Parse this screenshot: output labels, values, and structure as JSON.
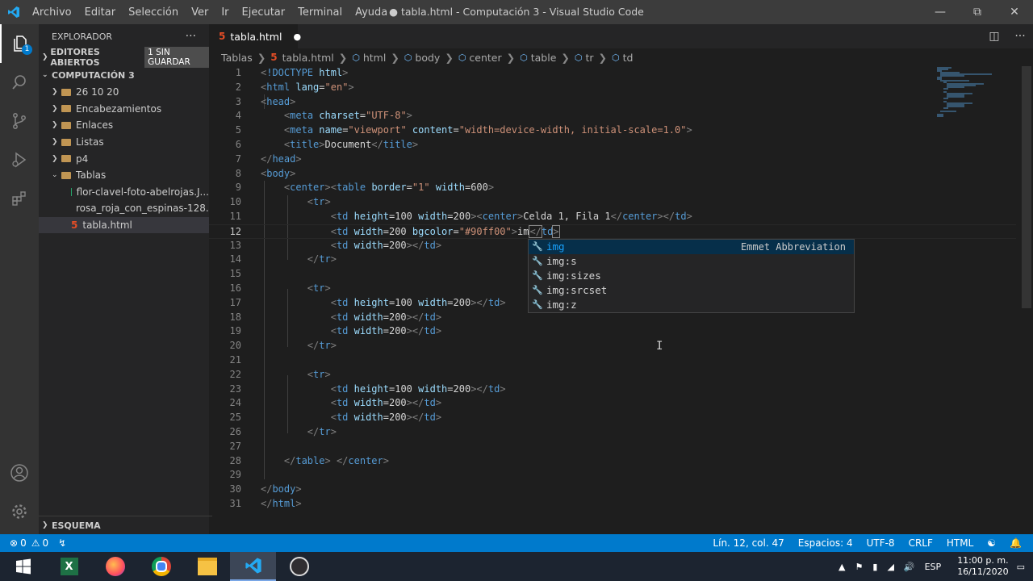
{
  "titlebar": {
    "menu": [
      "Archivo",
      "Editar",
      "Selección",
      "Ver",
      "Ir",
      "Ejecutar",
      "Terminal",
      "Ayuda"
    ],
    "title": "● tabla.html - Computación 3 - Visual Studio Code"
  },
  "activity_badge": "1",
  "sidebar": {
    "header": "EXPLORADOR",
    "open_editors": "EDITORES ABIERTOS",
    "unsaved_badge": "1 SIN GUARDAR",
    "workspace": "COMPUTACIÓN 3",
    "items": [
      {
        "label": "26 10 20",
        "kind": "folder"
      },
      {
        "label": "Encabezamientos",
        "kind": "folder"
      },
      {
        "label": "Enlaces",
        "kind": "folder"
      },
      {
        "label": "Listas",
        "kind": "folder"
      },
      {
        "label": "p4",
        "kind": "folder"
      },
      {
        "label": "Tablas",
        "kind": "folder-open"
      },
      {
        "label": "flor-clavel-foto-abelrojas.J...",
        "kind": "image"
      },
      {
        "label": "rosa_roja_con_espinas-128...",
        "kind": "image"
      },
      {
        "label": "tabla.html",
        "kind": "html"
      }
    ],
    "outline": "ESQUEMA"
  },
  "tab": {
    "label": "tabla.html",
    "icon": "html5-icon"
  },
  "breadcrumb": [
    "Tablas",
    "tabla.html",
    "html",
    "body",
    "center",
    "table",
    "tr",
    "td"
  ],
  "line_numbers": [
    "1",
    "2",
    "3",
    "4",
    "5",
    "6",
    "7",
    "8",
    "9",
    "10",
    "11",
    "12",
    "13",
    "14",
    "15",
    "16",
    "17",
    "18",
    "19",
    "20",
    "21",
    "22",
    "23",
    "24",
    "25",
    "26",
    "27",
    "28",
    "29",
    "30",
    "31"
  ],
  "suggest": {
    "typed": "im",
    "items": [
      "img",
      "img:s",
      "img:sizes",
      "img:srcset",
      "img:z"
    ],
    "detail": "Emmet Abbreviation"
  },
  "status": {
    "errors": "0",
    "warnings": "0",
    "position": "Lín. 12, col. 47",
    "spaces": "Espacios: 4",
    "encoding": "UTF-8",
    "eol": "CRLF",
    "language": "HTML"
  },
  "taskbar": {
    "lang": "ESP",
    "time": "11:00 p. m.",
    "date": "16/11/2020"
  },
  "colors": {
    "accent": "#007acc",
    "tag": "#569cd6",
    "attr": "#9cdcfe",
    "string": "#ce9178"
  }
}
